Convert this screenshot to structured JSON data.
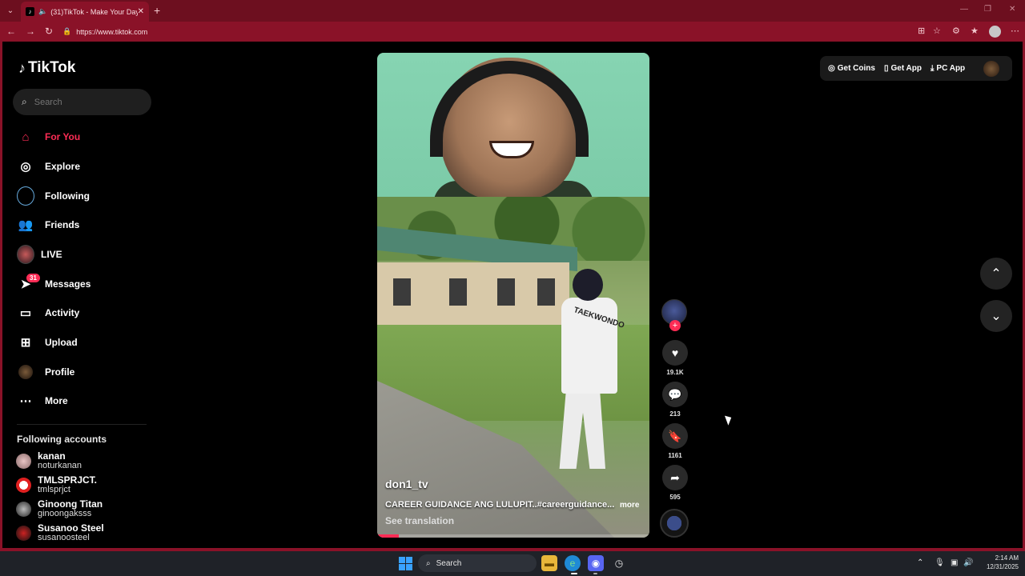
{
  "browser": {
    "tab_title": "(31)TikTok - Make Your Day",
    "url": "https://www.tiktok.com"
  },
  "sidebar": {
    "logo": "TikTok",
    "search_placeholder": "Search",
    "items": [
      {
        "label": "For You",
        "icon": "home-icon",
        "active": true
      },
      {
        "label": "Explore",
        "icon": "compass-icon"
      },
      {
        "label": "Following",
        "icon": "avatar"
      },
      {
        "label": "Friends",
        "icon": "friends-icon"
      },
      {
        "label": "LIVE",
        "icon": "live-avatar"
      },
      {
        "label": "Messages",
        "icon": "send-icon",
        "badge": "31"
      },
      {
        "label": "Activity",
        "icon": "activity-icon"
      },
      {
        "label": "Upload",
        "icon": "plus-square-icon"
      },
      {
        "label": "Profile",
        "icon": "profile-avatar"
      },
      {
        "label": "More",
        "icon": "more-icon"
      }
    ],
    "following_title": "Following accounts",
    "following_accounts": [
      {
        "name": "kanan",
        "handle": "noturkanan"
      },
      {
        "name": "TMLSPRJCT.",
        "handle": "tmlsprjct"
      },
      {
        "name": "Ginoong Titan",
        "handle": "ginoongaksss"
      },
      {
        "name": "Susanoo Steel",
        "handle": "susanoosteel"
      }
    ]
  },
  "video": {
    "username": "don1_tv",
    "description": "CAREER GUIDANCE ANG LULUPIT..#careerguidance...",
    "more": "more",
    "see_translation": "See translation",
    "shirt_text": "TAEKWONDO",
    "progress": 0.08
  },
  "actions": {
    "likes": "19.1K",
    "comments": "213",
    "saves": "1161",
    "shares": "595"
  },
  "header": {
    "get_coins": "Get Coins",
    "get_app": "Get App",
    "pc_app": "PC App"
  },
  "taskbar": {
    "search": "Search",
    "time": "2:14 AM",
    "date": "12/31/2025"
  },
  "colors": {
    "accent": "#fe2c55",
    "browser_frame": "#8a1228"
  }
}
